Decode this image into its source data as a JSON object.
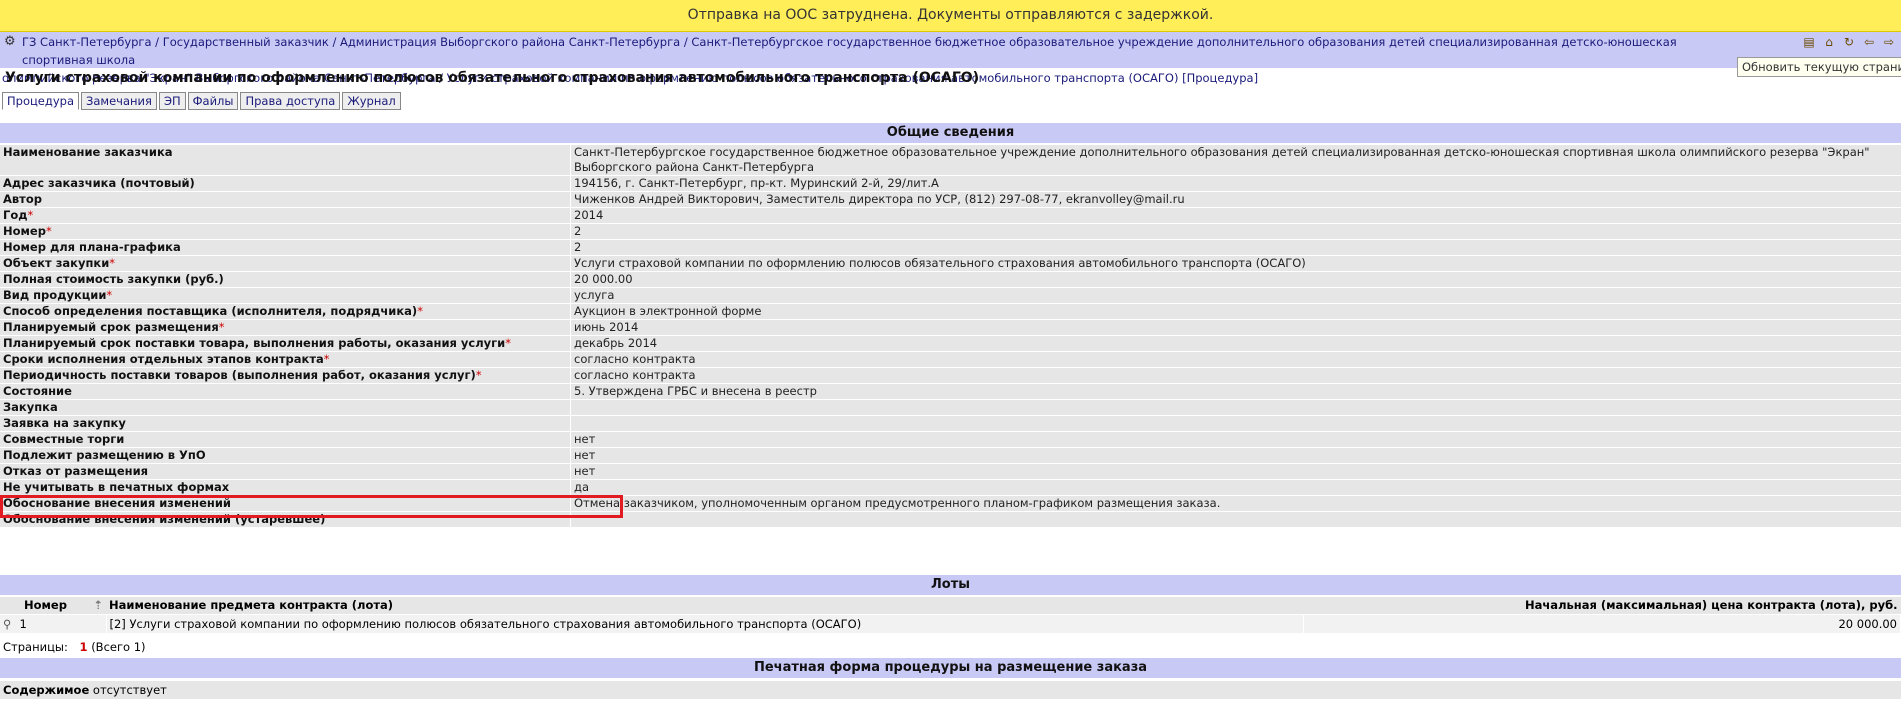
{
  "notice": "Отправка на ООС затруднена. Документы отправляются с задержкой.",
  "breadcrumb": {
    "line1": "ГЗ Санкт-Петербурга / Государственный заказчик / Администрация Выборгского района Санкт-Петербурга / Санкт-Петербургское государственное бюджетное образовательное учреждение дополнительного образования детей специализированная детско-юношеская спортивная школа",
    "line2": "олимпийского резерва \"Экран\" Выборгского района Санкт-Петербурга / Услуги страховой компании по оформлению полюсов обязательного страхования автомобильного транспорта (ОСАГО) [Процедура]"
  },
  "tooltip": "Обновить текущую страницу",
  "page_title": "Услуги страховой компании по оформлению полюсов обязательного страхования автомобильного транспорта (ОСАГО)",
  "tabs": [
    "Процедура",
    "Замечания",
    "ЭП",
    "Файлы",
    "Права доступа",
    "Журнал"
  ],
  "general": {
    "heading": "Общие сведения",
    "rows": [
      {
        "label": "Наименование заказчика",
        "req": "",
        "value": "Санкт-Петербургское государственное бюджетное образовательное учреждение дополнительного образования детей специализированная детско-юношеская спортивная школа олимпийского резерва \"Экран\" Выборгского района Санкт-Петербурга"
      },
      {
        "label": "Адрес заказчика (почтовый)",
        "req": "",
        "value": "194156, г. Санкт-Петербург, пр-кт. Муринский 2-й, 29/лит.А"
      },
      {
        "label": "Автор",
        "req": "",
        "value": "Чиженков Андрей Викторович, Заместитель директора по УСР, (812) 297-08-77, ekranvolley@mail.ru"
      },
      {
        "label": "Год",
        "req": "*",
        "value": "2014"
      },
      {
        "label": "Номер",
        "req": "*",
        "value": "2"
      },
      {
        "label": "Номер для плана-графика",
        "req": "",
        "value": "2"
      },
      {
        "label": "Объект закупки",
        "req": "*",
        "value": "Услуги страховой компании по оформлению полюсов обязательного страхования автомобильного транспорта (ОСАГО)"
      },
      {
        "label": "Полная стоимость закупки (руб.)",
        "req": "",
        "value": "20 000.00"
      },
      {
        "label": "Вид продукции",
        "req": "*",
        "value": "услуга"
      },
      {
        "label": "Способ определения поставщика (исполнителя, подрядчика)",
        "req": "*",
        "value": "Аукцион в электронной форме"
      },
      {
        "label": "Планируемый срок размещения",
        "req": "*",
        "value": "июнь 2014"
      },
      {
        "label": "Планируемый срок поставки товара, выполнения работы, оказания услуги",
        "req": "*",
        "value": "декабрь 2014"
      },
      {
        "label": "Сроки исполнения отдельных этапов контракта",
        "req": "*",
        "value": "согласно контракта"
      },
      {
        "label": "Периодичность поставки товаров (выполнения работ, оказания услуг)",
        "req": "*",
        "value": "согласно контракта"
      },
      {
        "label": "Состояние",
        "req": "",
        "value": "5. Утверждена ГРБС и внесена в реестр"
      },
      {
        "label": "Закупка",
        "req": "",
        "value": ""
      },
      {
        "label": "Заявка на закупку",
        "req": "",
        "value": ""
      },
      {
        "label": "Совместные торги",
        "req": "",
        "value": "нет"
      },
      {
        "label": "Подлежит размещению в УпО",
        "req": "",
        "value": "нет"
      },
      {
        "label": "Отказ от размещения",
        "req": "",
        "value": "нет"
      },
      {
        "label": "Не учитывать в печатных формах",
        "req": "",
        "value": "да"
      },
      {
        "label": "Обоснование внесения изменений",
        "req": "",
        "value": "Отмена заказчиком, уполномоченным органом предусмотренного планом-графиком размещения заказа."
      },
      {
        "label": "Обоснование внесения изменений (устаревшее)",
        "req": "",
        "value": ""
      }
    ]
  },
  "lots": {
    "heading": "Лоты",
    "columns": {
      "number": "Номер",
      "name": "Наименование предмета контракта (лота)",
      "price": "Начальная (максимальная) цена контракта (лота), руб."
    },
    "rows": [
      {
        "number": "1",
        "name": "[2] Услуги страховой компании по оформлению полюсов обязательного страхования автомобильного транспорта (ОСАГО)",
        "price": "20 000.00"
      }
    ],
    "pages_label": "Страницы:",
    "pages_current": "1",
    "pages_total": "(Всего 1)"
  },
  "print_form": {
    "heading": "Печатная форма процедуры на размещение заказа",
    "content_label": "Содержимое",
    "content_value": "отсутствует"
  }
}
